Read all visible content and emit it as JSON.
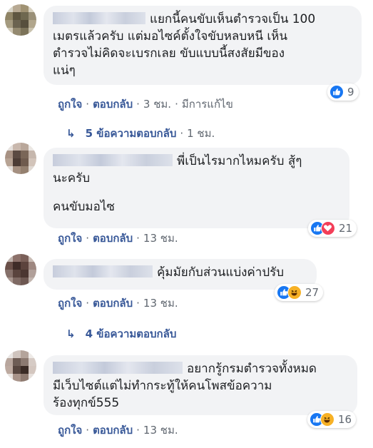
{
  "comments": [
    {
      "author": "",
      "text_lines": [
        "แยกนี้คนขับเห็นตำรวจเป็น 100",
        "เมตรแล้วครับ แต่มอไซค์ตั้งใจขับหลบหนี เห็น",
        "ตำรวจไม่คิดจะเบรกเลย ขับแบบนี้สงสัยมีของ",
        "แน่ๆ"
      ],
      "like_label": "ถูกใจ",
      "reply_label": "ตอบกลับ",
      "time": "3 ชม.",
      "edited": "มีการแก้ไข",
      "reaction_count": "9",
      "reactions": [
        "like-icon"
      ]
    },
    {
      "author": "",
      "text_lines": [
        "พี่เป็นไรมากไหมครับ สู้ๆ",
        "นะครับ",
        "คนขับมอไซ"
      ],
      "like_label": "ถูกใจ",
      "reply_label": "ตอบกลับ",
      "time": "13 ชม.",
      "reaction_count": "21",
      "reactions": [
        "like-icon",
        "love-icon"
      ]
    },
    {
      "author": "",
      "text_lines": [
        "คุ้มมัยกับส่วนแบ่งค่าปรับ"
      ],
      "like_label": "ถูกใจ",
      "reply_label": "ตอบกลับ",
      "time": "13 ชม.",
      "reaction_count": "27",
      "reactions": [
        "like-icon",
        "haha-icon"
      ]
    },
    {
      "author": "",
      "text_lines": [
        "อยากรู้กรมตำรวจทั้งหมด",
        "มีเว็บไซต์แต่ไม่ทำกระทู้ให้คนโพสข้อความ",
        "ร้องทุกข์555"
      ],
      "like_label": "ถูกใจ",
      "reply_label": "ตอบกลับ",
      "time": "13 ชม.",
      "reaction_count": "16",
      "reactions": [
        "like-icon",
        "haha-icon"
      ]
    }
  ],
  "reply_threads": [
    {
      "arrow": "↳",
      "label": "5 ข้อความตอบกลับ",
      "time": "1 ชม."
    },
    {
      "arrow": "↳",
      "label": "4 ข้อความตอบกลับ"
    }
  ],
  "colors": {
    "link": "#385898",
    "meta": "#606770",
    "bubble": "#f2f3f5",
    "like": "#1877f2",
    "love": "#f33e58",
    "haha": "#f7b125"
  }
}
